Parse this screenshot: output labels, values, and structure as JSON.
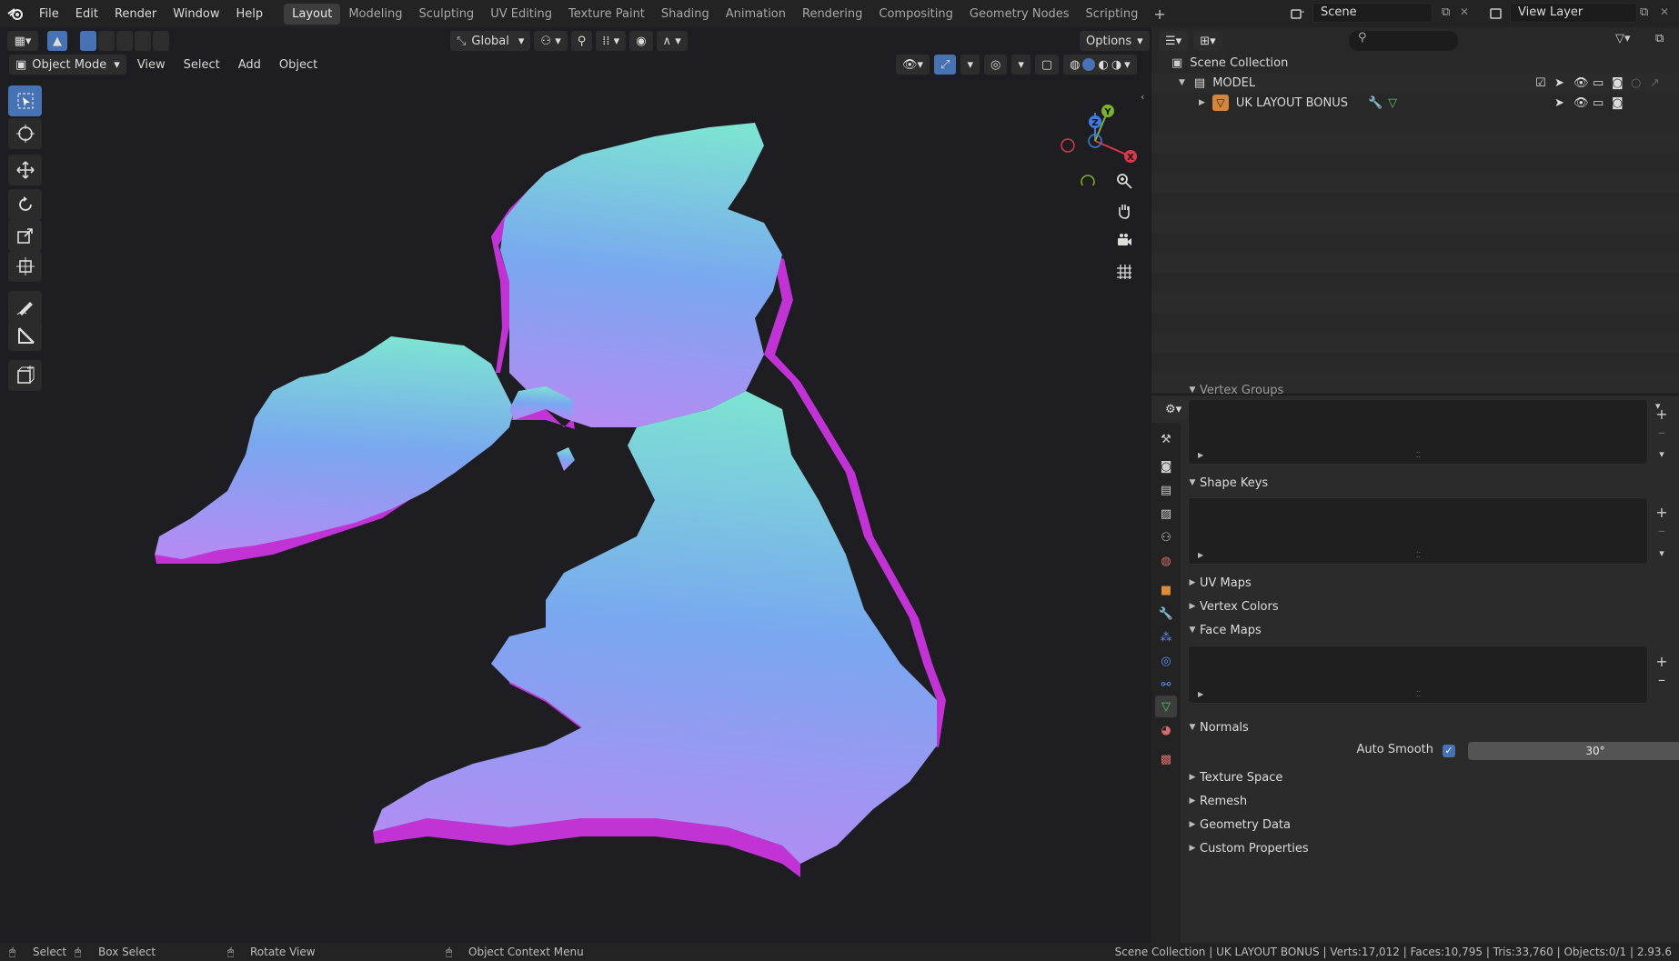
{
  "menu": [
    "File",
    "Edit",
    "Render",
    "Window",
    "Help"
  ],
  "workspaces": [
    "Layout",
    "Modeling",
    "Sculpting",
    "UV Editing",
    "Texture Paint",
    "Shading",
    "Animation",
    "Rendering",
    "Compositing",
    "Geometry Nodes",
    "Scripting"
  ],
  "active_workspace": "Layout",
  "scene": "Scene",
  "view_layer": "View Layer",
  "viewport": {
    "orientation": "Global",
    "options_label": "Options",
    "mode": "Object Mode",
    "header_menus": [
      "View",
      "Select",
      "Add",
      "Object"
    ],
    "gizmo_axes": [
      "Y",
      "Z",
      "X"
    ]
  },
  "outliner": {
    "root": "Scene Collection",
    "collection": "MODEL",
    "object": "UK LAYOUT BONUS"
  },
  "properties": {
    "top_cut_label": "Vertex Groups",
    "sections": [
      "Shape Keys",
      "UV Maps",
      "Vertex Colors",
      "Face Maps",
      "Normals",
      "Texture Space",
      "Remesh",
      "Geometry Data",
      "Custom Properties"
    ],
    "auto_smooth_label": "Auto Smooth",
    "auto_smooth_checked": true,
    "auto_smooth_angle": "30°"
  },
  "status": {
    "select": "Select",
    "box_select": "Box Select",
    "rotate_view": "Rotate View",
    "context_menu": "Object Context Menu",
    "stats": "Scene Collection | UK LAYOUT BONUS | Verts:17,012 | Faces:10,795 | Tris:33,760 | Objects:0/1 | 2.93.6"
  },
  "colors": {
    "accent": "#4772b3",
    "map_top_start": "#7de3d2",
    "map_top_mid": "#79a7f0",
    "map_top_end": "#b38cf3",
    "map_side": "#c233d6"
  }
}
